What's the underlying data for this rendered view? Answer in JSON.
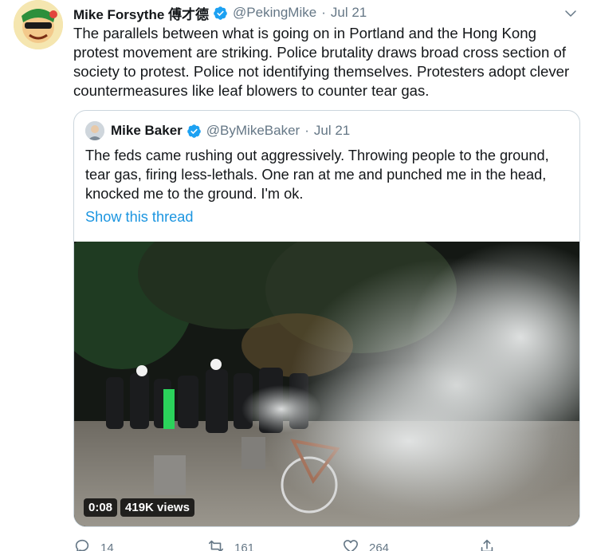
{
  "tweet": {
    "author_name": "Mike Forsythe 傅才德",
    "author_handle": "@PekingMike",
    "separator": "·",
    "date": "Jul 21",
    "text": "The parallels between what is going on in Portland and the Hong Kong protest movement are striking. Police brutality draws broad cross section of society to protest. Police not identifying themselves. Protesters adopt clever countermeasures like leaf blowers to counter tear gas.",
    "verified": true
  },
  "quoted": {
    "author_name": "Mike Baker",
    "author_handle": "@ByMikeBaker",
    "separator": "·",
    "date": "Jul 21",
    "text": "The feds came rushing out aggressively. Throwing people to the ground, tear gas, firing less-lethals. One ran at me and punched me in the head, knocked me to the ground. I'm ok.",
    "show_thread": "Show this thread",
    "verified": true,
    "video": {
      "duration": "0:08",
      "views": "419K views"
    }
  },
  "actions": {
    "reply_count": "14",
    "retweet_count": "161",
    "like_count": "264"
  },
  "colors": {
    "accent": "#1b95e0",
    "muted": "#657786",
    "border": "#ccd6dd"
  },
  "icons": [
    "verified-icon",
    "caret-down-icon",
    "reply-icon",
    "retweet-icon",
    "like-icon",
    "share-icon"
  ]
}
